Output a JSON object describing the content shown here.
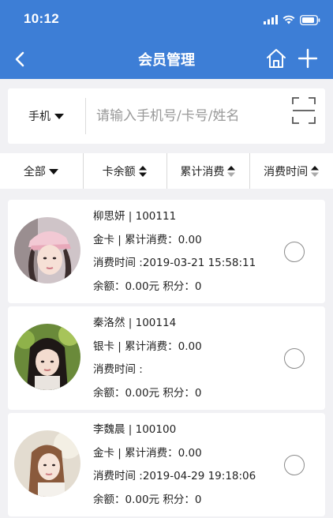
{
  "status_bar": {
    "time": "10:12"
  },
  "nav": {
    "title": "会员管理"
  },
  "search": {
    "type_label": "手机",
    "placeholder": "请输入手机号/卡号/姓名"
  },
  "filters": [
    {
      "label": "全部"
    },
    {
      "label": "卡余额"
    },
    {
      "label": "累计消费"
    },
    {
      "label": "消费时间"
    }
  ],
  "labels": {
    "total_spent": "累计消费：",
    "last_spent_time": "消费时间 :",
    "balance": "余额：",
    "points": "积分："
  },
  "members": [
    {
      "name_id": "柳思妍 | 100111",
      "card_type": "金卡 | ",
      "total_spent": "0.00",
      "last_time": "2019-03-21 15:58:11",
      "balance": "0.00元",
      "points": "0"
    },
    {
      "name_id": "秦洛然 | 100114",
      "card_type": "银卡 | ",
      "total_spent": "0.00",
      "last_time": "",
      "balance": "0.00元",
      "points": "0"
    },
    {
      "name_id": "李魏晨 | 100100",
      "card_type": "金卡 | ",
      "total_spent": "0.00",
      "last_time": "2019-04-29 19:18:06",
      "balance": "0.00元",
      "points": "0"
    }
  ],
  "colors": {
    "header_bg": "#3d7ed6",
    "page_bg": "#f1f1f4"
  },
  "icons": [
    "back-icon",
    "home-icon",
    "plus-icon",
    "scan-icon",
    "caret-down-icon",
    "sort-icon",
    "signal-icon",
    "wifi-icon",
    "battery-icon"
  ]
}
